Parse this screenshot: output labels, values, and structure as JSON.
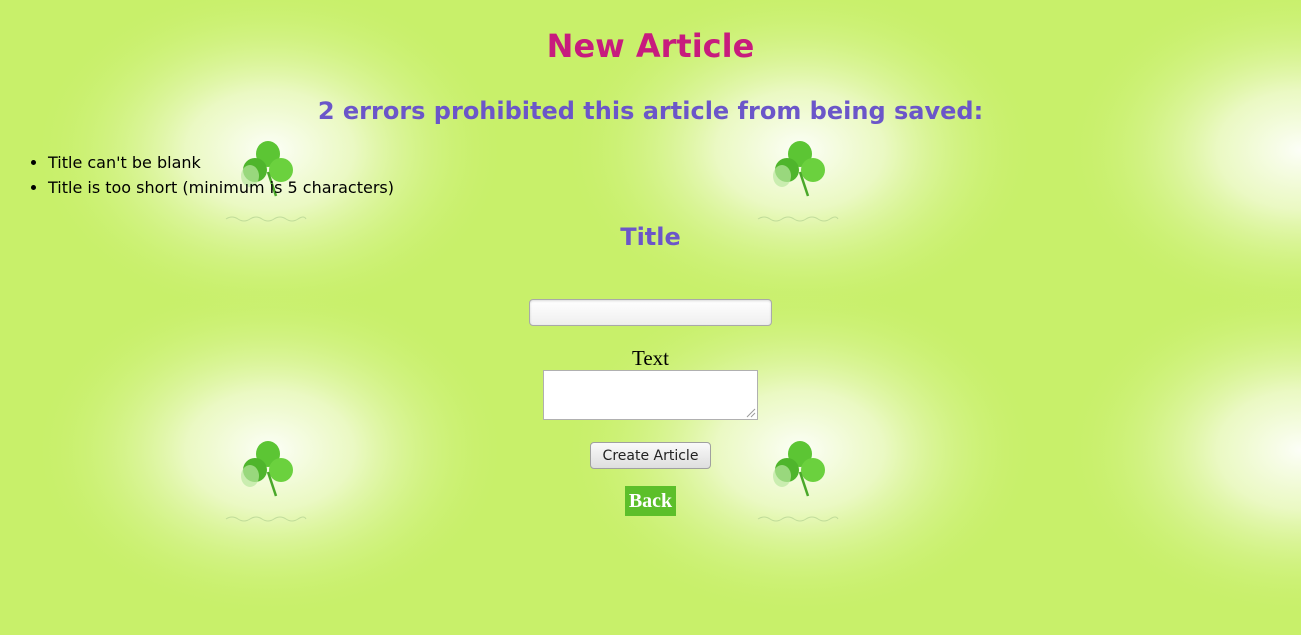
{
  "page": {
    "title": "New Article",
    "background_color": "#c8f06a",
    "background_image": "shamrock-tile-pattern"
  },
  "errors": {
    "heading": "2 errors prohibited this article from being saved:",
    "items": [
      "Title can't be blank",
      "Title is too short (minimum is 5 characters)"
    ]
  },
  "form": {
    "title_label": "Title",
    "title_value": "",
    "text_label": "Text",
    "text_value": "",
    "submit_label": "Create Article"
  },
  "nav": {
    "back_label": "Back"
  },
  "colors": {
    "page_title": "#c71b7e",
    "heading": "#6b56c9",
    "back_link_bg": "#5cbf2a"
  }
}
